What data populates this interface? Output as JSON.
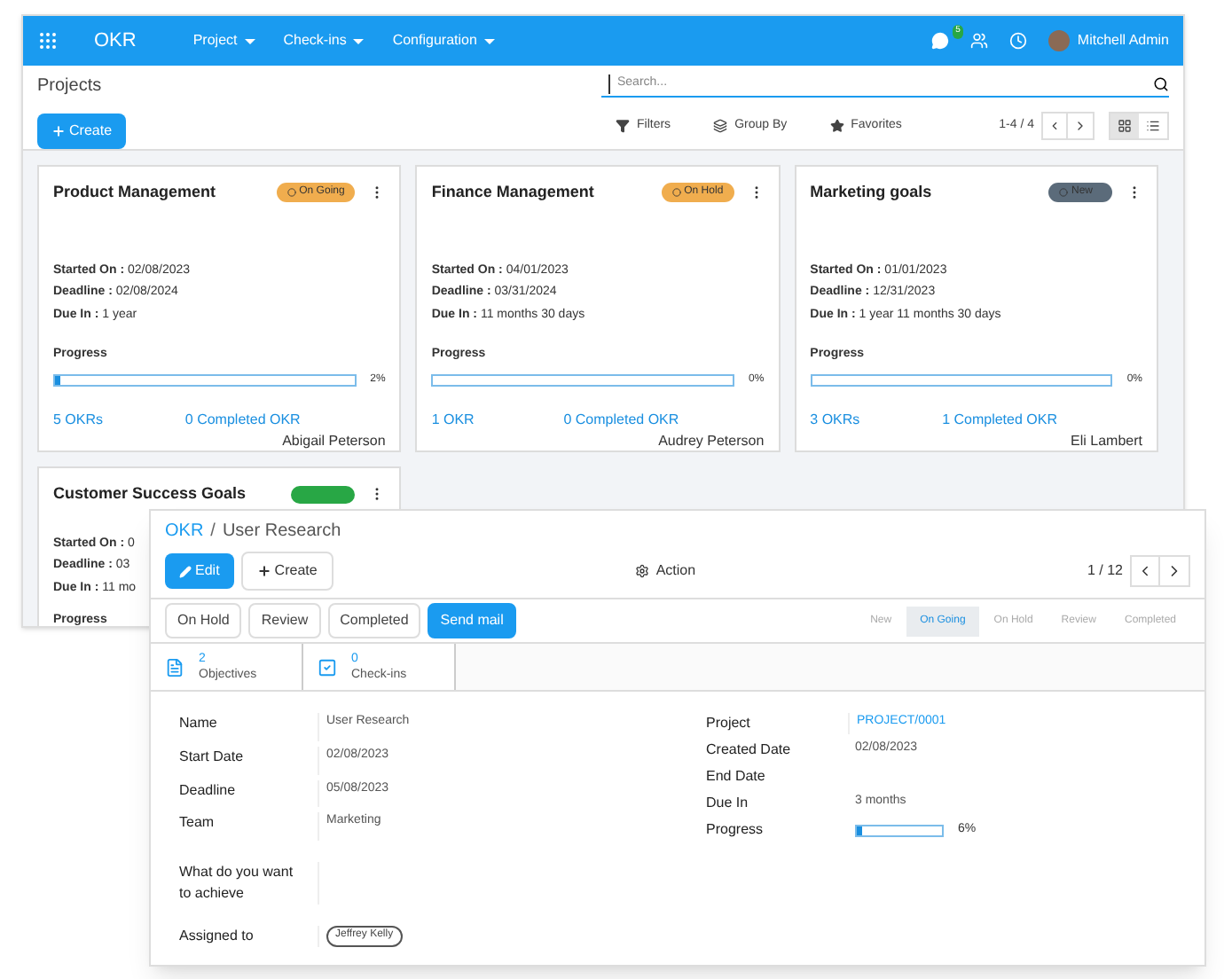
{
  "navbar": {
    "app": "OKR",
    "menus": [
      "Project",
      "Check-ins",
      "Configuration"
    ],
    "chat_count": "5",
    "user": "Mitchell Admin"
  },
  "control_panel": {
    "title": "Projects",
    "create": "Create",
    "search": {
      "placeholder": "Search..."
    },
    "filters": [
      {
        "kind": "filter",
        "label": "Filters"
      },
      {
        "kind": "group",
        "label": "Group By"
      },
      {
        "kind": "favorite",
        "label": "Favorites"
      }
    ],
    "pager": "1-4 / 4",
    "views": [
      {
        "kind": "kanban",
        "selected": true
      },
      {
        "kind": "list",
        "selected": false
      }
    ]
  },
  "cards": [
    {
      "title": "Product Management",
      "status": "On Going",
      "color": "#f0ad4e",
      "fields": [
        {
          "label": "Started On :",
          "value": "02/08/2023"
        },
        {
          "label": "Deadline :",
          "value": "02/08/2024"
        },
        {
          "label": "Due In :",
          "value": "1 year"
        }
      ],
      "progress_label": "Progress",
      "level": 0.02,
      "percent": "2%",
      "okrs": "5 OKRs",
      "completed": "0 Completed OKR",
      "owner": "Abigail Peterson"
    },
    {
      "title": "Finance Management",
      "status": "On Hold",
      "color": "#f0ad4e",
      "fields": [
        {
          "label": "Started On :",
          "value": "04/01/2023"
        },
        {
          "label": "Deadline :",
          "value": "03/31/2024"
        },
        {
          "label": "Due In :",
          "value": "11 months 30 days"
        }
      ],
      "progress_label": "Progress",
      "level": 0,
      "percent": "0%",
      "okrs": "1 OKR",
      "completed": "0 Completed OKR",
      "owner": "Audrey Peterson"
    },
    {
      "title": "Marketing goals",
      "status": "New",
      "color": "#5b6b7a",
      "fields": [
        {
          "label": "Started On :",
          "value": "01/01/2023"
        },
        {
          "label": "Deadline :",
          "value": "12/31/2023"
        },
        {
          "label": "Due In :",
          "value": "1 year 11 months 30 days"
        }
      ],
      "progress_label": "Progress",
      "level": 0,
      "percent": "0%",
      "okrs": "3 OKRs",
      "completed": "1 Completed OKR",
      "owner": "Eli Lambert"
    },
    {
      "title": "Customer Success Goals",
      "color": "#28a745",
      "fields": [
        {
          "label": "Started On :",
          "value": "0"
        },
        {
          "label": "Deadline :",
          "value": "03"
        },
        {
          "label": "Due In :",
          "value": "11 mo"
        }
      ],
      "progress_label": "Progress"
    }
  ],
  "form": {
    "parent": "OKR",
    "separator": "/",
    "current": "User Research",
    "edit": "Edit",
    "create": "Create",
    "action": "Action",
    "pager": "1 / 12",
    "header_buttons": [
      {
        "label": "On Hold",
        "primary": false
      },
      {
        "label": "Review",
        "primary": false
      },
      {
        "label": "Completed",
        "primary": false
      },
      {
        "label": "Send mail",
        "primary": true
      }
    ],
    "stages": [
      {
        "label": "New",
        "selected": false
      },
      {
        "label": "On Going",
        "selected": true
      },
      {
        "label": "On Hold",
        "selected": false
      },
      {
        "label": "Review",
        "selected": false
      },
      {
        "label": "Completed",
        "selected": false
      }
    ],
    "smart_buttons": [
      {
        "kind": "document",
        "count": "2",
        "label": "Objectives"
      },
      {
        "kind": "checkbox",
        "count": "0",
        "label": "Check-ins"
      }
    ],
    "left_fields": [
      {
        "label": "Name",
        "value": "User Research"
      },
      {
        "label": "Start Date",
        "value": "02/08/2023"
      },
      {
        "label": "Deadline",
        "value": "05/08/2023"
      },
      {
        "label": "Team",
        "value": "Marketing"
      }
    ],
    "right_fields": [
      {
        "kind": "link",
        "label": "Project",
        "value": "PROJECT/0001"
      },
      {
        "kind": "text",
        "label": "Created Date",
        "value": "02/08/2023"
      },
      {
        "kind": "text",
        "label": "End Date"
      },
      {
        "kind": "text",
        "label": "Due In",
        "value": "3 months"
      },
      {
        "kind": "progress",
        "label": "Progress",
        "level": 0.06,
        "value": "6%"
      }
    ],
    "achieve_label": "What do you want to achieve",
    "assigned_label": "Assigned to",
    "assigned_tags": [
      "Jeffrey Kelly"
    ]
  }
}
